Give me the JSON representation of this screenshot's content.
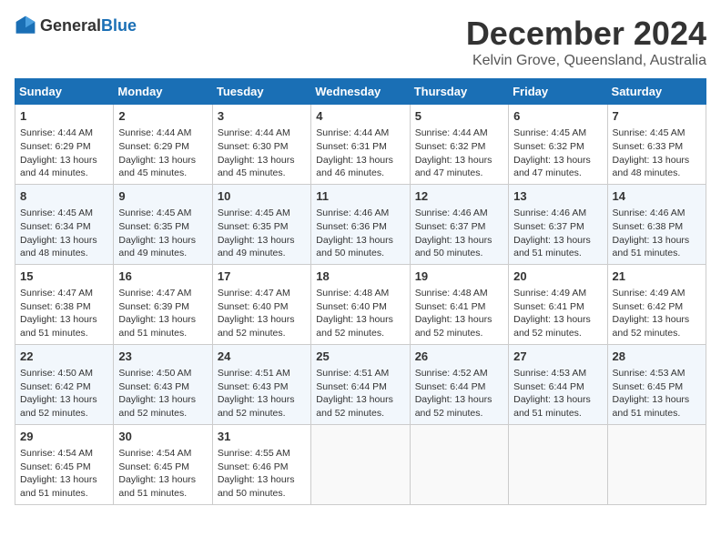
{
  "header": {
    "logo_general": "General",
    "logo_blue": "Blue",
    "month_title": "December 2024",
    "location": "Kelvin Grove, Queensland, Australia"
  },
  "days_of_week": [
    "Sunday",
    "Monday",
    "Tuesday",
    "Wednesday",
    "Thursday",
    "Friday",
    "Saturday"
  ],
  "weeks": [
    [
      {
        "day": "1",
        "sunrise": "4:44 AM",
        "sunset": "6:29 PM",
        "daylight": "13 hours and 44 minutes."
      },
      {
        "day": "2",
        "sunrise": "4:44 AM",
        "sunset": "6:29 PM",
        "daylight": "13 hours and 45 minutes."
      },
      {
        "day": "3",
        "sunrise": "4:44 AM",
        "sunset": "6:30 PM",
        "daylight": "13 hours and 45 minutes."
      },
      {
        "day": "4",
        "sunrise": "4:44 AM",
        "sunset": "6:31 PM",
        "daylight": "13 hours and 46 minutes."
      },
      {
        "day": "5",
        "sunrise": "4:44 AM",
        "sunset": "6:32 PM",
        "daylight": "13 hours and 47 minutes."
      },
      {
        "day": "6",
        "sunrise": "4:45 AM",
        "sunset": "6:32 PM",
        "daylight": "13 hours and 47 minutes."
      },
      {
        "day": "7",
        "sunrise": "4:45 AM",
        "sunset": "6:33 PM",
        "daylight": "13 hours and 48 minutes."
      }
    ],
    [
      {
        "day": "8",
        "sunrise": "4:45 AM",
        "sunset": "6:34 PM",
        "daylight": "13 hours and 48 minutes."
      },
      {
        "day": "9",
        "sunrise": "4:45 AM",
        "sunset": "6:35 PM",
        "daylight": "13 hours and 49 minutes."
      },
      {
        "day": "10",
        "sunrise": "4:45 AM",
        "sunset": "6:35 PM",
        "daylight": "13 hours and 49 minutes."
      },
      {
        "day": "11",
        "sunrise": "4:46 AM",
        "sunset": "6:36 PM",
        "daylight": "13 hours and 50 minutes."
      },
      {
        "day": "12",
        "sunrise": "4:46 AM",
        "sunset": "6:37 PM",
        "daylight": "13 hours and 50 minutes."
      },
      {
        "day": "13",
        "sunrise": "4:46 AM",
        "sunset": "6:37 PM",
        "daylight": "13 hours and 51 minutes."
      },
      {
        "day": "14",
        "sunrise": "4:46 AM",
        "sunset": "6:38 PM",
        "daylight": "13 hours and 51 minutes."
      }
    ],
    [
      {
        "day": "15",
        "sunrise": "4:47 AM",
        "sunset": "6:38 PM",
        "daylight": "13 hours and 51 minutes."
      },
      {
        "day": "16",
        "sunrise": "4:47 AM",
        "sunset": "6:39 PM",
        "daylight": "13 hours and 51 minutes."
      },
      {
        "day": "17",
        "sunrise": "4:47 AM",
        "sunset": "6:40 PM",
        "daylight": "13 hours and 52 minutes."
      },
      {
        "day": "18",
        "sunrise": "4:48 AM",
        "sunset": "6:40 PM",
        "daylight": "13 hours and 52 minutes."
      },
      {
        "day": "19",
        "sunrise": "4:48 AM",
        "sunset": "6:41 PM",
        "daylight": "13 hours and 52 minutes."
      },
      {
        "day": "20",
        "sunrise": "4:49 AM",
        "sunset": "6:41 PM",
        "daylight": "13 hours and 52 minutes."
      },
      {
        "day": "21",
        "sunrise": "4:49 AM",
        "sunset": "6:42 PM",
        "daylight": "13 hours and 52 minutes."
      }
    ],
    [
      {
        "day": "22",
        "sunrise": "4:50 AM",
        "sunset": "6:42 PM",
        "daylight": "13 hours and 52 minutes."
      },
      {
        "day": "23",
        "sunrise": "4:50 AM",
        "sunset": "6:43 PM",
        "daylight": "13 hours and 52 minutes."
      },
      {
        "day": "24",
        "sunrise": "4:51 AM",
        "sunset": "6:43 PM",
        "daylight": "13 hours and 52 minutes."
      },
      {
        "day": "25",
        "sunrise": "4:51 AM",
        "sunset": "6:44 PM",
        "daylight": "13 hours and 52 minutes."
      },
      {
        "day": "26",
        "sunrise": "4:52 AM",
        "sunset": "6:44 PM",
        "daylight": "13 hours and 52 minutes."
      },
      {
        "day": "27",
        "sunrise": "4:53 AM",
        "sunset": "6:44 PM",
        "daylight": "13 hours and 51 minutes."
      },
      {
        "day": "28",
        "sunrise": "4:53 AM",
        "sunset": "6:45 PM",
        "daylight": "13 hours and 51 minutes."
      }
    ],
    [
      {
        "day": "29",
        "sunrise": "4:54 AM",
        "sunset": "6:45 PM",
        "daylight": "13 hours and 51 minutes."
      },
      {
        "day": "30",
        "sunrise": "4:54 AM",
        "sunset": "6:45 PM",
        "daylight": "13 hours and 51 minutes."
      },
      {
        "day": "31",
        "sunrise": "4:55 AM",
        "sunset": "6:46 PM",
        "daylight": "13 hours and 50 minutes."
      },
      {
        "day": "",
        "sunrise": "",
        "sunset": "",
        "daylight": ""
      },
      {
        "day": "",
        "sunrise": "",
        "sunset": "",
        "daylight": ""
      },
      {
        "day": "",
        "sunrise": "",
        "sunset": "",
        "daylight": ""
      },
      {
        "day": "",
        "sunrise": "",
        "sunset": "",
        "daylight": ""
      }
    ]
  ]
}
